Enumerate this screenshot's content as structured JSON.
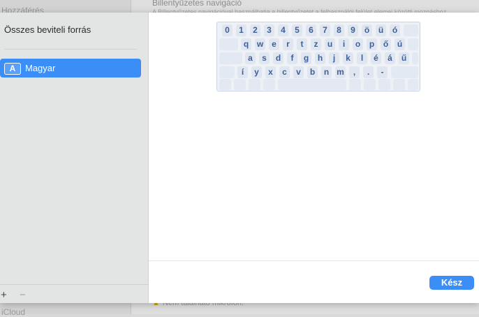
{
  "background": {
    "sidebar_top_text": "Hozzáférés",
    "sidebar_bottom_text": "iCloud",
    "section_title": "Billentyűzetes navigáció",
    "section_sub": "A Billentyűzetes navigációval használhatja a billentyűzetet a felhasználói felület elemei közötti mozgáshoz",
    "footer_warning_icon": "warning-icon",
    "footer_text": "Nem található mikrofon."
  },
  "sheet": {
    "heading": "Összes beviteli forrás",
    "source": {
      "icon": "A",
      "label": "Magyar"
    },
    "add_label": "+",
    "remove_label": "−",
    "done_label": "Kész"
  },
  "keyboard": {
    "rows": [
      [
        "0",
        "1",
        "2",
        "3",
        "4",
        "5",
        "6",
        "7",
        "8",
        "9",
        "ö",
        "ü",
        "ó"
      ],
      [
        "q",
        "w",
        "e",
        "r",
        "t",
        "z",
        "u",
        "i",
        "o",
        "p",
        "ő",
        "ú"
      ],
      [
        "a",
        "s",
        "d",
        "f",
        "g",
        "h",
        "j",
        "k",
        "l",
        "é",
        "á",
        "ű"
      ],
      [
        "í",
        "y",
        "x",
        "c",
        "v",
        "b",
        "n",
        "m",
        ",",
        ".",
        "-"
      ]
    ]
  },
  "colors": {
    "accent": "#3c8ef7",
    "key_text": "#3f5f99"
  }
}
